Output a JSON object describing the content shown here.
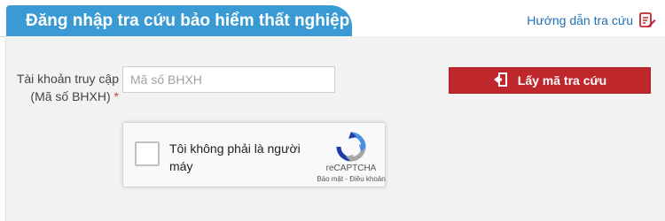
{
  "header": {
    "title": "Đăng nhập tra cứu bảo hiểm thất nghiệp",
    "guide_link": "Hướng dẫn tra cứu",
    "guide_icon": "edit-document-icon"
  },
  "form": {
    "account_label_line1": "Tài khoản truy cập",
    "account_label_line2": "(Mã số BHXH)",
    "required_mark": "*",
    "account_placeholder": "Mã số BHXH",
    "account_value": "",
    "get_code_button": "Lấy mã tra cứu",
    "get_code_icon": "door-exit-icon"
  },
  "recaptcha": {
    "label": "Tôi không phải là người máy",
    "brand": "reCAPTCHA",
    "terms": "Bảo mật - Điều khoản",
    "checked": false
  },
  "colors": {
    "header_tab": "#3a9ad4",
    "link": "#1f6fb5",
    "button": "#c0272d",
    "panel": "#f2f2f2",
    "required": "#d33b3b"
  }
}
